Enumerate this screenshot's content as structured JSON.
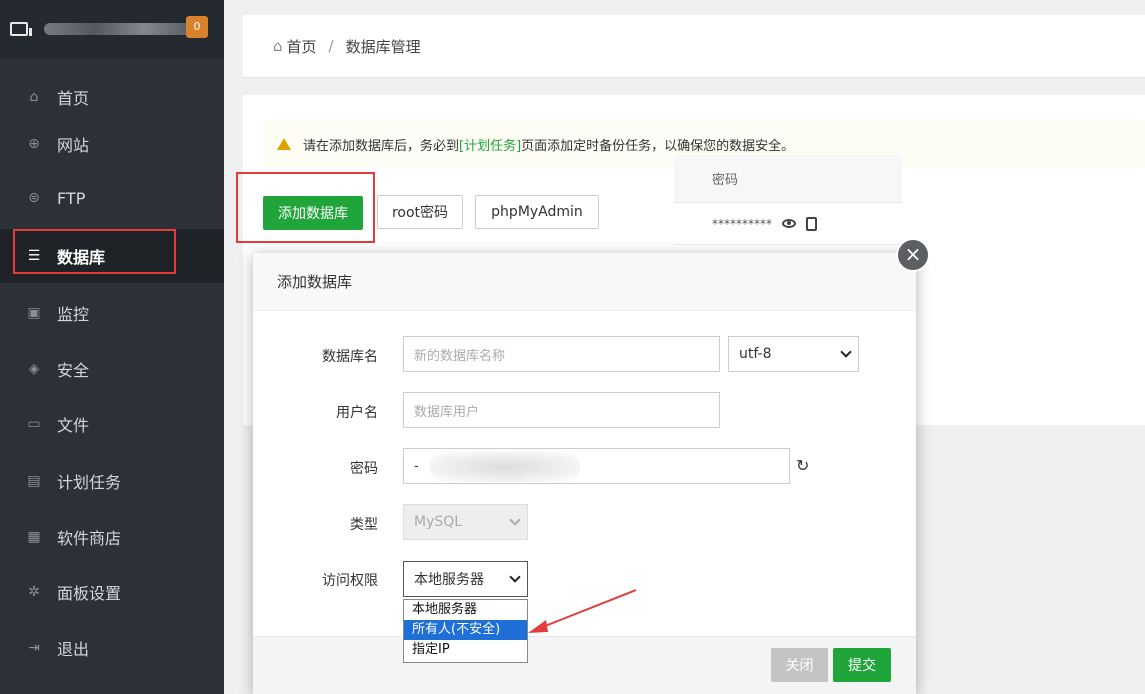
{
  "sidebar": {
    "badge": "0",
    "items": [
      {
        "icon": "home-icon",
        "glyph": "⌂",
        "label": "首页"
      },
      {
        "icon": "globe-icon",
        "glyph": "⊕",
        "label": "网站"
      },
      {
        "icon": "ftp-icon",
        "glyph": "⊜",
        "label": "FTP"
      },
      {
        "icon": "database-icon",
        "glyph": "☰",
        "label": "数据库"
      },
      {
        "icon": "monitor-icon",
        "glyph": "▣",
        "label": "监控"
      },
      {
        "icon": "shield-icon",
        "glyph": "◈",
        "label": "安全"
      },
      {
        "icon": "folder-icon",
        "glyph": "▭",
        "label": "文件"
      },
      {
        "icon": "calendar-icon",
        "glyph": "▤",
        "label": "计划任务"
      },
      {
        "icon": "grid-icon",
        "glyph": "▦",
        "label": "软件商店"
      },
      {
        "icon": "settings-icon",
        "glyph": "✲",
        "label": "面板设置"
      },
      {
        "icon": "logout-icon",
        "glyph": "⇥",
        "label": "退出"
      }
    ]
  },
  "breadcrumb": {
    "home": "首页",
    "sep": "/",
    "current": "数据库管理"
  },
  "notice": {
    "before": "请在添加数据库后，务必到",
    "link": "[计划任务]",
    "after": "页面添加定时备份任务，以确保您的数据安全。"
  },
  "toolbar": {
    "add_db": "添加数据库",
    "root_pw": "root密码",
    "phpmyadmin": "phpMyAdmin"
  },
  "table": {
    "header_password": "密码",
    "row_password": "**********"
  },
  "modal": {
    "title": "添加数据库",
    "close_glyph": "×",
    "db_name_label": "数据库名",
    "db_name_placeholder": "新的数据库名称",
    "charset": "utf-8",
    "user_label": "用户名",
    "user_placeholder": "数据库用户",
    "password_label": "密码",
    "password_value": "-",
    "type_label": "类型",
    "type_value": "MySQL",
    "access_label": "访问权限",
    "access_value": "本地服务器",
    "access_options": [
      "本地服务器",
      "所有人(不安全)",
      "指定IP"
    ],
    "btn_close": "关闭",
    "btn_submit": "提交"
  },
  "colors": {
    "accent_green": "#20a53a",
    "highlight_red": "#e23c3c",
    "sidebar_bg": "#2c3138",
    "select_blue": "#1e70d8"
  }
}
